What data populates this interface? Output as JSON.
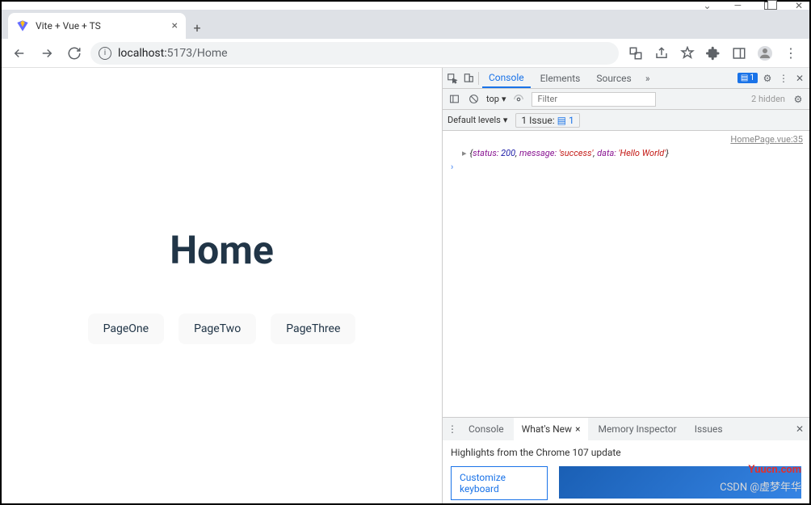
{
  "window": {
    "tab_title": "Vite + Vue + TS"
  },
  "address": {
    "host": "localhost:",
    "port_path": "5173/Home"
  },
  "page": {
    "heading": "Home",
    "buttons": [
      "PageOne",
      "PageTwo",
      "PageThree"
    ]
  },
  "devtools": {
    "tabs": {
      "console": "Console",
      "elements": "Elements",
      "sources": "Sources"
    },
    "issue_count": "1",
    "toolbar": {
      "context": "top",
      "filter_placeholder": "Filter",
      "hidden": "2 hidden",
      "levels": "Default levels",
      "issue_label": "1 Issue:",
      "issue_badge": "1"
    },
    "console": {
      "source": "HomePage.vue:35",
      "obj": {
        "open": "{",
        "k_status": "status:",
        "v_status": "200",
        "k_message": "message:",
        "v_message": "'success'",
        "k_data": "data:",
        "v_data": "'Hello World'",
        "close": "}"
      }
    },
    "drawer": {
      "tabs": {
        "console": "Console",
        "whatsnew": "What's New",
        "memory": "Memory Inspector",
        "issues": "Issues"
      },
      "highlights": "Highlights from the Chrome 107 update",
      "card1_line1": "Customize",
      "card1_line2": "keyboard"
    }
  },
  "watermarks": {
    "wm1": "Yuucn.com",
    "wm2": "CSDN @虚梦年华"
  }
}
